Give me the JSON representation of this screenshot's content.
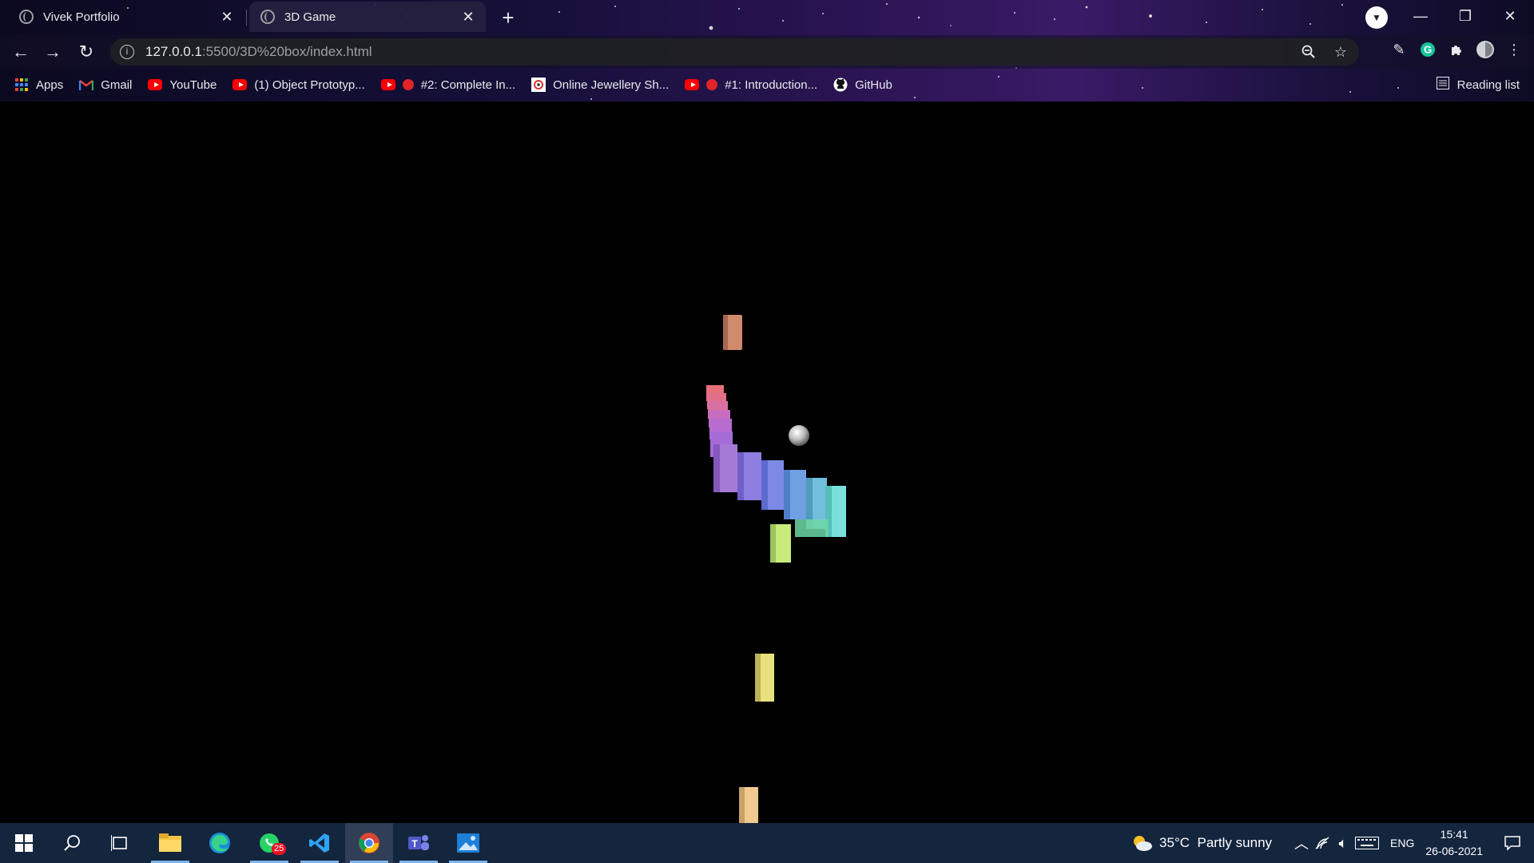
{
  "browser": {
    "tabs": [
      {
        "title": "Vivek Portfolio",
        "active": false
      },
      {
        "title": "3D Game",
        "active": true
      }
    ],
    "url": {
      "host": "127.0.0.1",
      "path": ":5500/3D%20box/index.html"
    },
    "bookmarks": [
      {
        "label": "Apps",
        "icon": "apps-grid-icon"
      },
      {
        "label": "Gmail",
        "icon": "gmail-icon"
      },
      {
        "label": "YouTube",
        "icon": "youtube-icon"
      },
      {
        "label": "(1) Object Prototyp...",
        "icon": "youtube-icon"
      },
      {
        "label": "#2: Complete In...",
        "icon": "youtube-icon"
      },
      {
        "label": "Online Jewellery Sh...",
        "icon": "site-icon"
      },
      {
        "label": "#1: Introduction...",
        "icon": "youtube-icon"
      },
      {
        "label": "GitHub",
        "icon": "github-icon"
      }
    ],
    "reading_list": "Reading list"
  },
  "taskbar": {
    "apps": [
      "windows-start",
      "search",
      "task-view",
      "file-explorer",
      "edge",
      "whatsapp",
      "vscode",
      "chrome",
      "teams",
      "photos"
    ],
    "whatsapp_badge": "25",
    "weather": "35°C  Partly sunny",
    "language": "ENG",
    "time": "15:41",
    "date": "26-06-2021"
  },
  "colors": {
    "tab_active": "#262140",
    "omnibox": "#202124",
    "taskbar": "#14253e",
    "accent_blue": "#7eb4ea"
  }
}
